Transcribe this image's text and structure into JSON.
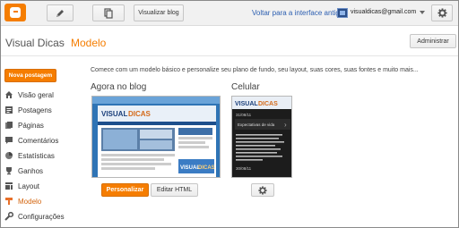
{
  "topbar": {
    "view_blog_label": "Visualizar blog",
    "old_interface_link": "Voltar para a interface antiga",
    "account_email": "visualdicas@gmail.com"
  },
  "header": {
    "blog_name": "Visual Dicas",
    "separator": "·",
    "page_title": "Modelo",
    "admin_button": "Administrar"
  },
  "sidebar": {
    "new_post_button": "Nova postagem",
    "items": [
      {
        "label": "Visão geral",
        "icon": "home-icon"
      },
      {
        "label": "Postagens",
        "icon": "posts-icon"
      },
      {
        "label": "Páginas",
        "icon": "pages-icon"
      },
      {
        "label": "Comentários",
        "icon": "comments-icon"
      },
      {
        "label": "Estatísticas",
        "icon": "stats-icon"
      },
      {
        "label": "Ganhos",
        "icon": "trophy-icon"
      },
      {
        "label": "Layout",
        "icon": "layout-icon"
      },
      {
        "label": "Modelo",
        "icon": "template-icon",
        "active": true
      },
      {
        "label": "Configurações",
        "icon": "wrench-icon"
      }
    ]
  },
  "main": {
    "intro": "Comece com um modelo básico e personalize seu plano de fundo, seu layout, suas cores, suas fontes e muito mais...",
    "desktop_title": "Agora no blog",
    "mobile_title": "Celular",
    "customize_button": "Personalizar",
    "edit_html_button": "Editar HTML",
    "desktop_preview": {
      "logo_text_1": "VISUAL",
      "logo_text_2": "DICAS"
    },
    "mobile_preview": {
      "logo_text_1": "VISUAL",
      "logo_text_2": "DICAS",
      "date_1": "31/08/11",
      "post_title": "Expectativas de vida",
      "post_excerpt": "Diante das expectativas de vida fiquei triste, de quando encuentra, nos palcofronteiro diante das expectativas que a vida se nos apresenta...",
      "date_2": "30/08/11"
    }
  },
  "colors": {
    "accent": "#f57d00",
    "link": "#2a5db0",
    "active_item": "#d3640d"
  }
}
